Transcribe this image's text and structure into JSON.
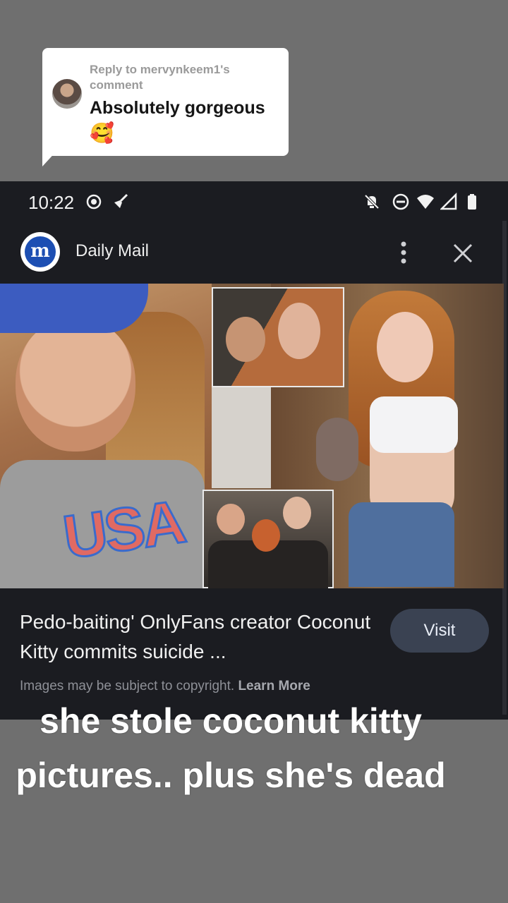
{
  "reply_bubble": {
    "reply_to": "Reply to mervynkeem1's comment",
    "comment_text": "Absolutely gorgeous",
    "emoji": "🥰"
  },
  "status_bar": {
    "time": "10:22"
  },
  "app_bar": {
    "title": "Daily Mail",
    "logo_letter": "m"
  },
  "article": {
    "headline": "Pedo-baiting' OnlyFans creator Coconut Kitty commits suicide ...",
    "visit_label": "Visit",
    "copyright_text": "Images may be subject to copyright.",
    "learn_more": "Learn More",
    "collage_text": "USA"
  },
  "caption": {
    "text": "she stole coconut kitty pictures.. plus she's dead"
  },
  "colors": {
    "background": "#6f6f6f",
    "phone_background": "#1b1c21",
    "visit_button": "#3a4252",
    "daily_mail_blue": "#1d4fb3"
  }
}
